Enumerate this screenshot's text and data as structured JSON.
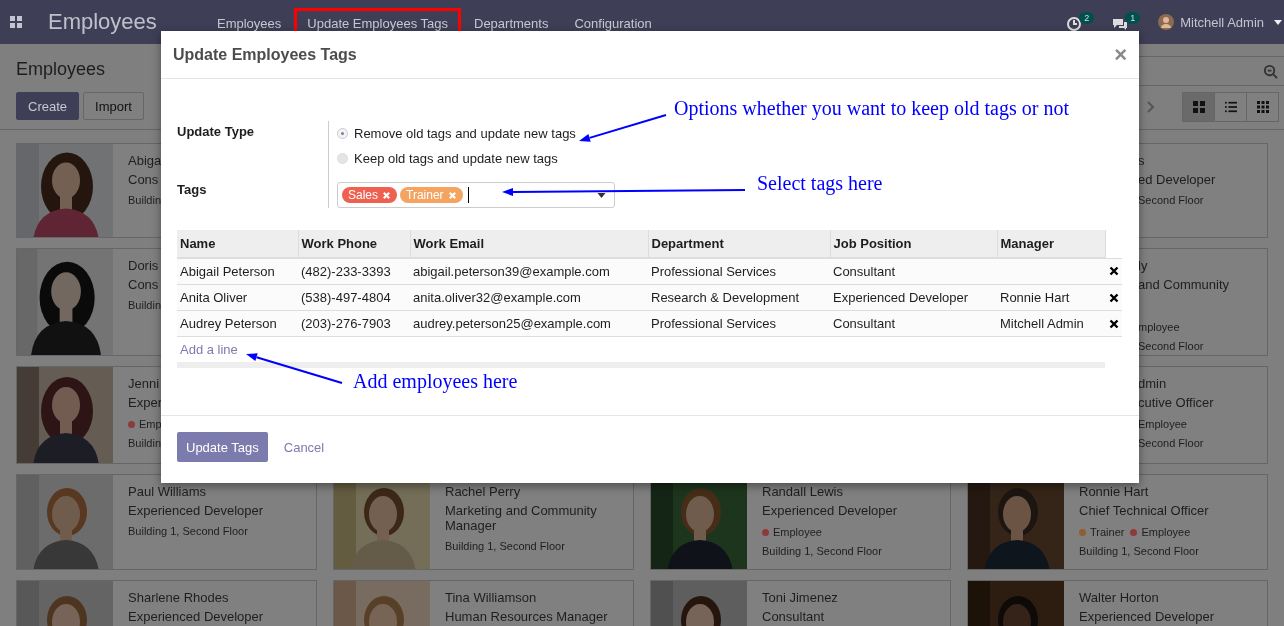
{
  "navbar": {
    "app_title": "Employees",
    "menu": [
      {
        "label": "Employees",
        "highlighted": false
      },
      {
        "label": "Update Employees Tags",
        "highlighted": true
      },
      {
        "label": "Departments",
        "highlighted": false
      },
      {
        "label": "Configuration",
        "highlighted": false
      }
    ],
    "activity_count": "2",
    "message_count": "1",
    "user": "Mitchell Admin"
  },
  "control_panel": {
    "breadcrumb": "Employees",
    "buttons": [
      {
        "label": "Create",
        "kind": "primary"
      },
      {
        "label": "Import",
        "kind": "secondary"
      }
    ],
    "views": [
      {
        "kind": "kanban",
        "selected": true
      },
      {
        "kind": "list",
        "selected": false
      },
      {
        "kind": "grid",
        "selected": false
      }
    ]
  },
  "kanban": {
    "left_cards": [
      {
        "name": "Abiga",
        "job": "Cons",
        "location": "Buildin",
        "photo": {
          "kind": "picture"
        }
      },
      {
        "name": "Doris",
        "job": "Cons",
        "location": "Buildin",
        "photo": {
          "kind": "picture"
        }
      },
      {
        "name": "Jenni",
        "job": "Exper",
        "tags": [
          {
            "label": "Emp",
            "color": "#8c3a3a"
          }
        ],
        "location": "Buildin",
        "photo": {
          "kind": "picture"
        }
      }
    ],
    "right_cards": [
      {
        "name": "s",
        "job": "ed Developer",
        "location": "Second Floor"
      },
      {
        "name": "ly",
        "job": "and Community",
        "tags": [
          {
            "label": "mployee"
          }
        ],
        "location": "Second Floor"
      },
      {
        "name": "dmin",
        "job": "cutive Officer",
        "tags": [
          {
            "label": "Employee"
          }
        ],
        "location": "Second Floor"
      }
    ],
    "rows": [
      [
        {
          "name": "Paul Williams",
          "job": "Experienced Developer",
          "location": "Building 1, Second Floor",
          "photo": {
            "kind": "picture"
          }
        },
        {
          "name": "Rachel Perry",
          "job": "Marketing and Community Manager",
          "location": "Building 1, Second Floor",
          "photo": {
            "kind": "picture"
          }
        },
        {
          "name": "Randall Lewis",
          "job": "Experienced Developer",
          "tags": [
            {
              "label": "Employee",
              "color": "#8c3a3a"
            }
          ],
          "location": "Building 1, Second Floor",
          "photo": {
            "kind": "picture"
          }
        },
        {
          "name": "Ronnie Hart",
          "job": "Chief Technical Officer",
          "tags": [
            {
              "label": "Trainer",
              "color": "#8c5e30"
            },
            {
              "label": "Employee",
              "color": "#8c3a3a"
            }
          ],
          "location": "Building 1, Second Floor",
          "photo": {
            "kind": "picture"
          }
        }
      ],
      [
        {
          "name": "Sharlene Rhodes",
          "job": "Experienced Developer",
          "photo": {
            "kind": "picture"
          }
        },
        {
          "name": "Tina Williamson",
          "job": "Human Resources Manager",
          "photo": {
            "kind": "picture"
          }
        },
        {
          "name": "Toni Jimenez",
          "job": "Consultant",
          "photo": {
            "kind": "picture"
          }
        },
        {
          "name": "Walter Horton",
          "job": "Experienced Developer",
          "photo": {
            "kind": "picture"
          }
        }
      ]
    ]
  },
  "dialog": {
    "title": "Update Employees Tags",
    "close": "×",
    "update_type": {
      "label": "Update Type",
      "options": [
        {
          "label": "Remove old tags and update new tags",
          "selected": true
        },
        {
          "label": "Keep old tags and update new tags",
          "selected": false
        }
      ]
    },
    "tags": {
      "label": "Tags",
      "items": [
        {
          "label": "Sales",
          "color": "#f06050"
        },
        {
          "label": "Trainer",
          "color": "#f4a460"
        }
      ]
    },
    "table": {
      "columns": [
        "Name",
        "Work Phone",
        "Work Email",
        "Department",
        "Job Position",
        "Manager"
      ],
      "rows": [
        {
          "name": "Abigail Peterson",
          "work_phone": "(482)-233-3393",
          "work_email": "abigail.peterson39@example.com",
          "department": "Professional Services",
          "job_position": "Consultant"
        },
        {
          "name": "Anita Oliver",
          "work_phone": "(538)-497-4804",
          "work_email": "anita.oliver32@example.com",
          "department": "Research & Development",
          "job_position": "Experienced Developer",
          "manager": "Ronnie Hart"
        },
        {
          "name": "Audrey Peterson",
          "work_phone": "(203)-276-7903",
          "work_email": "audrey.peterson25@example.com",
          "department": "Professional Services",
          "job_position": "Consultant",
          "manager": "Mitchell Admin"
        }
      ],
      "add_line": "Add a line"
    },
    "buttons": [
      {
        "label": "Update Tags",
        "kind": "primary"
      },
      {
        "label": "Cancel",
        "kind": "link"
      }
    ]
  },
  "annotations": [
    {
      "text": "Options whether you want to keep old tags or not"
    },
    {
      "text": "Select tags here"
    },
    {
      "text": "Add employees here"
    }
  ]
}
